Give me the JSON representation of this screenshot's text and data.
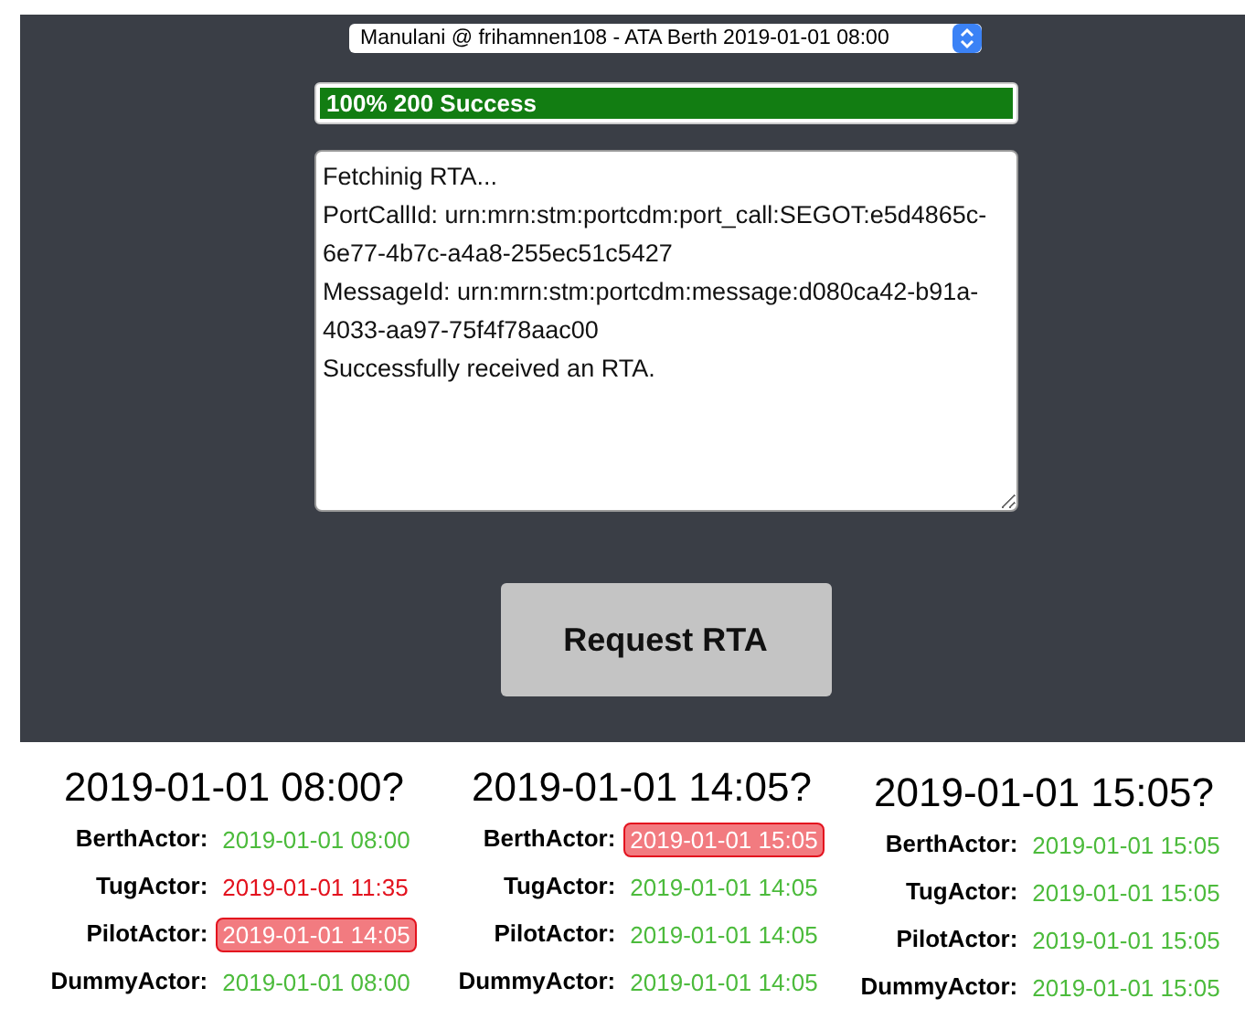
{
  "voyage_select": {
    "value": "Manulani @ frihamnen108 - ATA Berth 2019-01-01 08:00"
  },
  "progress": {
    "level": 1,
    "label": "100% 200 Success"
  },
  "log": {
    "lines": [
      "Fetchinig RTA...",
      "PortCallId: urn:mrn:stm:portcdm:port_call:SEGOT:e5d4865c-6e77-4b7c-a4a8-255ec51c5427",
      "MessageId: urn:mrn:stm:portcdm:message:d080ca42-b91a-4033-aa97-75f4f78aac00",
      "Successfully received an RTA."
    ]
  },
  "request_button": {
    "label": "Request RTA"
  },
  "columns": [
    {
      "title": "2019-01-01 08:00?",
      "actors": [
        {
          "name": "BerthActor:",
          "time": "2019-01-01 08:00",
          "mismatch": false,
          "flagged": false
        },
        {
          "name": "TugActor:",
          "time": "2019-01-01 11:35",
          "mismatch": true,
          "flagged": false
        },
        {
          "name": "PilotActor:",
          "time": "2019-01-01 14:05",
          "mismatch": true,
          "flagged": true
        },
        {
          "name": "DummyActor:",
          "time": "2019-01-01 08:00",
          "mismatch": false,
          "flagged": false
        }
      ]
    },
    {
      "title": "2019-01-01 14:05?",
      "actors": [
        {
          "name": "BerthActor:",
          "time": "2019-01-01 15:05",
          "mismatch": true,
          "flagged": true
        },
        {
          "name": "TugActor:",
          "time": "2019-01-01 14:05",
          "mismatch": false,
          "flagged": false
        },
        {
          "name": "PilotActor:",
          "time": "2019-01-01 14:05",
          "mismatch": false,
          "flagged": false
        },
        {
          "name": "DummyActor:",
          "time": "2019-01-01 14:05",
          "mismatch": false,
          "flagged": false
        }
      ]
    },
    {
      "title": "2019-01-01 15:05?",
      "actors": [
        {
          "name": "BerthActor:",
          "time": "2019-01-01 15:05",
          "mismatch": false,
          "flagged": false
        },
        {
          "name": "TugActor:",
          "time": "2019-01-01 15:05",
          "mismatch": false,
          "flagged": false
        },
        {
          "name": "PilotActor:",
          "time": "2019-01-01 15:05",
          "mismatch": false,
          "flagged": false
        },
        {
          "name": "DummyActor:",
          "time": "2019-01-01 15:05",
          "mismatch": false,
          "flagged": false
        }
      ]
    }
  ]
}
